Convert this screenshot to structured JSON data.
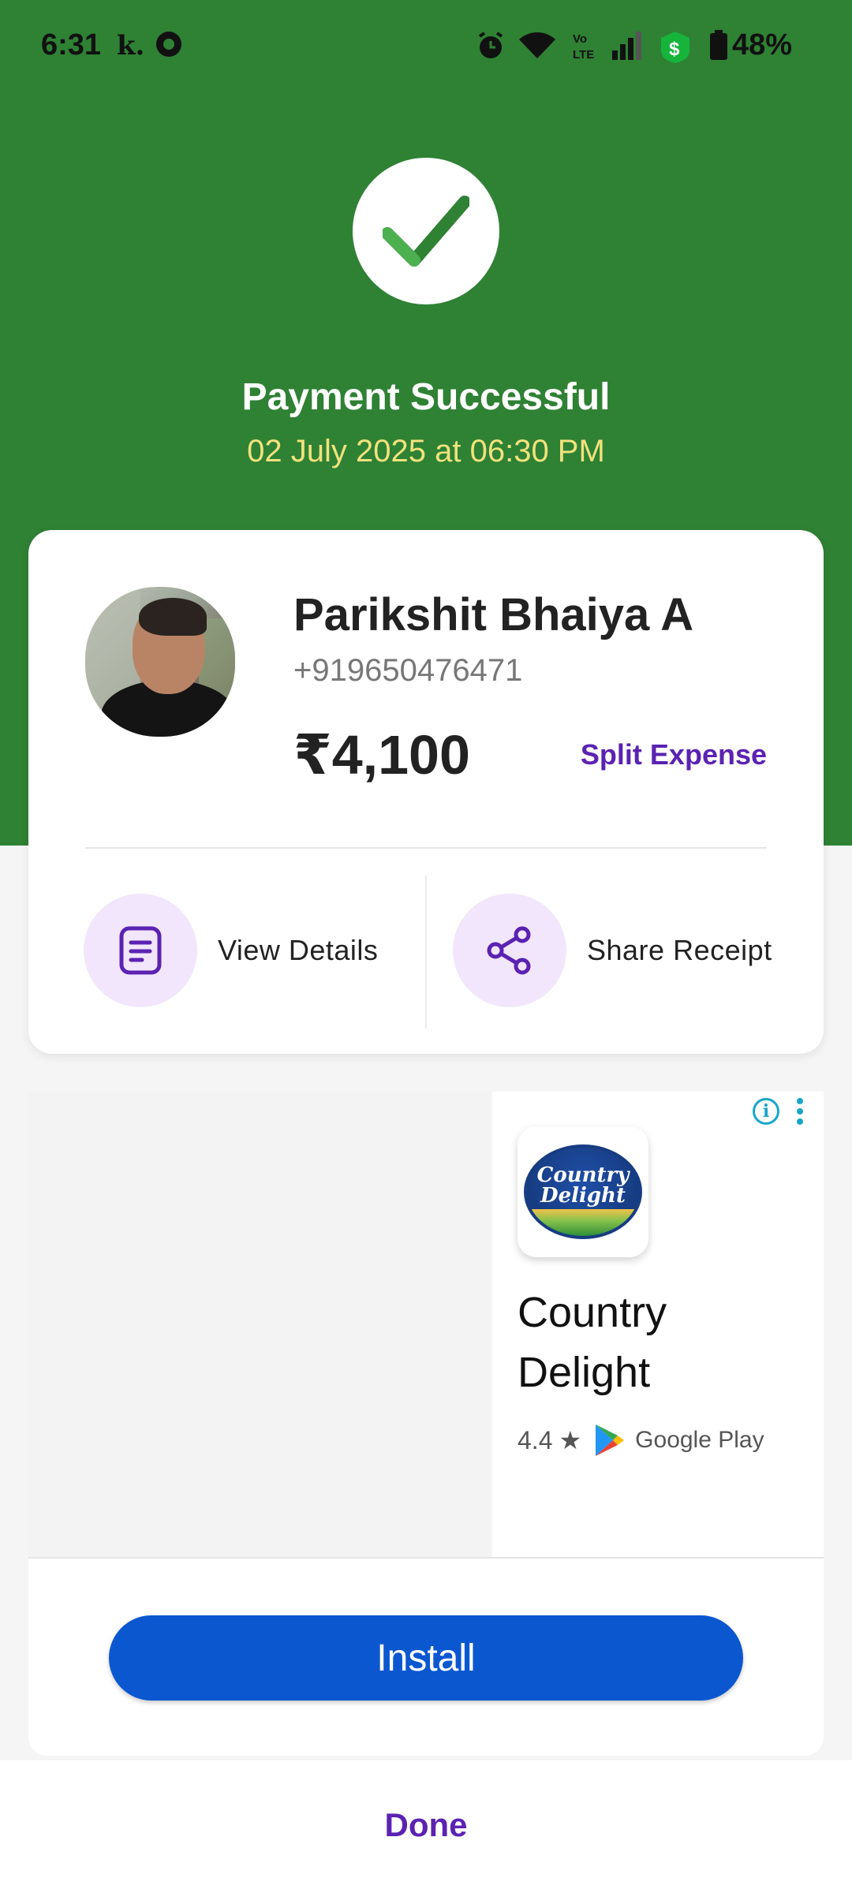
{
  "status_bar": {
    "time": "6:31",
    "carrier_glyph": "k.",
    "battery_percent": "48%",
    "icons": [
      "alarm-icon",
      "wifi-icon",
      "volte-icon",
      "signal-icon",
      "dollar-icon",
      "battery-icon"
    ]
  },
  "header": {
    "title": "Payment Successful",
    "datetime": "02 July 2025 at 06:30 PM"
  },
  "payee": {
    "name": "Parikshit Bhaiya A",
    "phone": "+919650476471",
    "amount": "₹4,100",
    "split_label": "Split Expense"
  },
  "actions": {
    "view_details": "View Details",
    "share_receipt": "Share Receipt"
  },
  "ad": {
    "logo_text": "Country Delight",
    "app_name": "Country Delight",
    "rating": "4.4",
    "store": "Google Play",
    "install_label": "Install"
  },
  "footer": {
    "done_label": "Done"
  },
  "colors": {
    "success_green": "#2f8134",
    "accent_purple": "#5b22b2",
    "install_blue": "#0b57d0",
    "date_yellow": "#f1e27c"
  }
}
